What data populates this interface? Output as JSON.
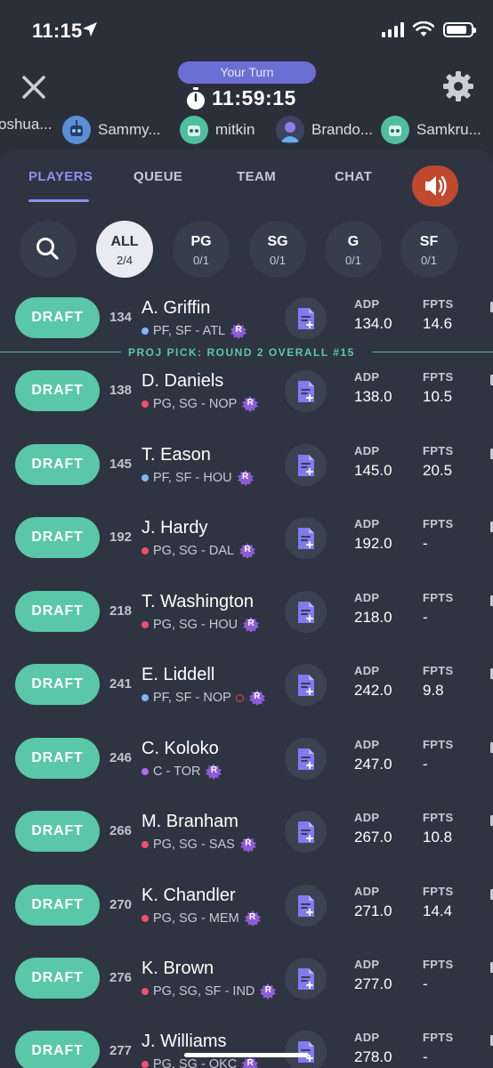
{
  "status_bar": {
    "time": "11:15"
  },
  "header": {
    "turn_label": "Your Turn",
    "timer": "11:59:15",
    "drafters": [
      "oshua...",
      "Sammy...",
      "mitkin",
      "Brando...",
      "Samkru..."
    ]
  },
  "tabs": [
    "PLAYERS",
    "QUEUE",
    "TEAM",
    "CHAT"
  ],
  "filters": [
    {
      "label": "ALL",
      "count": "2/4"
    },
    {
      "label": "PG",
      "count": "0/1"
    },
    {
      "label": "SG",
      "count": "0/1"
    },
    {
      "label": "G",
      "count": "0/1"
    },
    {
      "label": "SF",
      "count": "0/1"
    }
  ],
  "draft_label": "DRAFT",
  "adp_label": "ADP",
  "fpts_label": "FPTS",
  "proj_pick": "PROJ PICK: ROUND 2 OVERALL #15",
  "colors": {
    "accent": "#8d92f0",
    "draft": "#5ac8a8",
    "rookie": "#8e5cd6",
    "sound": "#c0492e"
  },
  "players": [
    {
      "rank": "134",
      "name": "A. Griffin",
      "info": "PF, SF - ATL",
      "pos_color": "#7fb6ff",
      "adp": "134.0",
      "fpts": "14.6",
      "injury": false
    },
    {
      "rank": "138",
      "name": "D. Daniels",
      "info": "PG, SG - NOP",
      "pos_color": "#f0506e",
      "adp": "138.0",
      "fpts": "10.5",
      "injury": false
    },
    {
      "rank": "145",
      "name": "T. Eason",
      "info": "PF, SF - HOU",
      "pos_color": "#7fb6ff",
      "adp": "145.0",
      "fpts": "20.5",
      "injury": false
    },
    {
      "rank": "192",
      "name": "J. Hardy",
      "info": "PG, SG - DAL",
      "pos_color": "#f0506e",
      "adp": "192.0",
      "fpts": "-",
      "injury": false
    },
    {
      "rank": "218",
      "name": "T. Washington",
      "info": "PG, SG - HOU",
      "pos_color": "#f0506e",
      "adp": "218.0",
      "fpts": "-",
      "injury": false
    },
    {
      "rank": "241",
      "name": "E. Liddell",
      "info": "PF, SF - NOP",
      "pos_color": "#7fb6ff",
      "adp": "242.0",
      "fpts": "9.8",
      "injury": true
    },
    {
      "rank": "246",
      "name": "C. Koloko",
      "info": "C - TOR",
      "pos_color": "#b46cf0",
      "adp": "247.0",
      "fpts": "-",
      "injury": false
    },
    {
      "rank": "266",
      "name": "M. Branham",
      "info": "PG, SG - SAS",
      "pos_color": "#f0506e",
      "adp": "267.0",
      "fpts": "10.8",
      "injury": false
    },
    {
      "rank": "270",
      "name": "K. Chandler",
      "info": "PG, SG - MEM",
      "pos_color": "#f0506e",
      "adp": "271.0",
      "fpts": "14.4",
      "injury": false
    },
    {
      "rank": "276",
      "name": "K. Brown",
      "info": "PG, SG, SF - IND",
      "pos_color": "#f0506e",
      "adp": "277.0",
      "fpts": "-",
      "injury": false
    },
    {
      "rank": "277",
      "name": "J. Williams",
      "info": "PG, SG - OKC",
      "pos_color": "#f0506e",
      "adp": "278.0",
      "fpts": "-",
      "injury": false
    }
  ]
}
